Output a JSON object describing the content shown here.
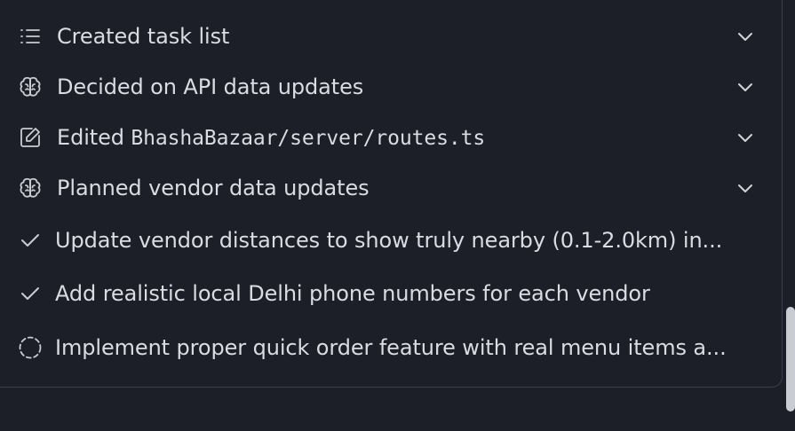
{
  "timeline": {
    "items": [
      {
        "icon": "list-icon",
        "label": "Created task list",
        "expandable": true
      },
      {
        "icon": "brain-icon",
        "label": "Decided on API data updates",
        "expandable": true
      },
      {
        "icon": "edit-icon",
        "label_prefix": "Edited ",
        "label_path": "BhashaBazaar/server/routes.ts",
        "expandable": true
      },
      {
        "icon": "brain-icon",
        "label": "Planned vendor data updates",
        "expandable": true
      }
    ],
    "tasks": [
      {
        "status": "completed",
        "icon": "check-icon",
        "label": "Update vendor distances to show truly nearby (0.1-2.0km) in..."
      },
      {
        "status": "completed",
        "icon": "check-icon",
        "label": "Add realistic local Delhi phone numbers for each vendor"
      },
      {
        "status": "pending",
        "icon": "dashed-circle-icon",
        "label": "Implement proper quick order feature with real menu items a..."
      }
    ]
  },
  "colors": {
    "background": "#1c1f27",
    "text": "#d9dce3",
    "border": "#3a3e49",
    "scrollbar": "#c9ccd3"
  }
}
